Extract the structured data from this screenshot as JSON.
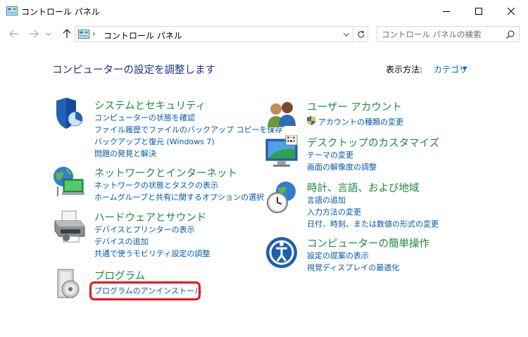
{
  "window": {
    "title": "コントロール パネル"
  },
  "address": {
    "crumb": "コントロール パネル",
    "search_placeholder": "コントロール パネルの検索"
  },
  "main": {
    "heading": "コンピューターの設定を調整します",
    "view_by_label": "表示方法:",
    "view_by_value": "カテゴリ"
  },
  "categories": {
    "system": {
      "title": "システムとセキュリティ",
      "links": [
        "コンピューターの状態を確認",
        "ファイル履歴でファイルのバックアップ コピーを保存",
        "バックアップと復元 (Windows 7)",
        "問題の発見と解決"
      ]
    },
    "network": {
      "title": "ネットワークとインターネット",
      "links": [
        "ネットワークの状態とタスクの表示",
        "ホームグループと共有に関するオプションの選択"
      ]
    },
    "hardware": {
      "title": "ハードウェアとサウンド",
      "links": [
        "デバイスとプリンターの表示",
        "デバイスの追加",
        "共通で使うモビリティ設定の調整"
      ]
    },
    "programs": {
      "title": "プログラム",
      "links": [
        "プログラムのアンインストール"
      ]
    },
    "users": {
      "title": "ユーザー アカウント",
      "links": [
        "アカウントの種類の変更"
      ]
    },
    "desktop": {
      "title": "デスクトップのカスタマイズ",
      "links": [
        "テーマの変更",
        "画面の解像度の調整"
      ]
    },
    "clock": {
      "title": "時計、言語、および地域",
      "links": [
        "言語の追加",
        "入力方法の変更",
        "日付、時刻、または数値の形式の変更"
      ]
    },
    "ease": {
      "title": "コンピューターの簡単操作",
      "links": [
        "設定の提案の表示",
        "視覚ディスプレイの最適化"
      ]
    }
  },
  "colors": {
    "heading": "#1e3287",
    "category_title": "#1c8a3a",
    "link": "#0058b0",
    "highlight": "#e8101a"
  },
  "icons": {
    "window": "control-panel-icon",
    "system": "shield-icon",
    "network": "globe-network-icon",
    "hardware": "printer-icon",
    "programs": "program-disc-icon",
    "users": "users-icon",
    "desktop": "desktop-monitor-icon",
    "clock": "clock-globe-icon",
    "ease": "ease-of-access-icon"
  }
}
